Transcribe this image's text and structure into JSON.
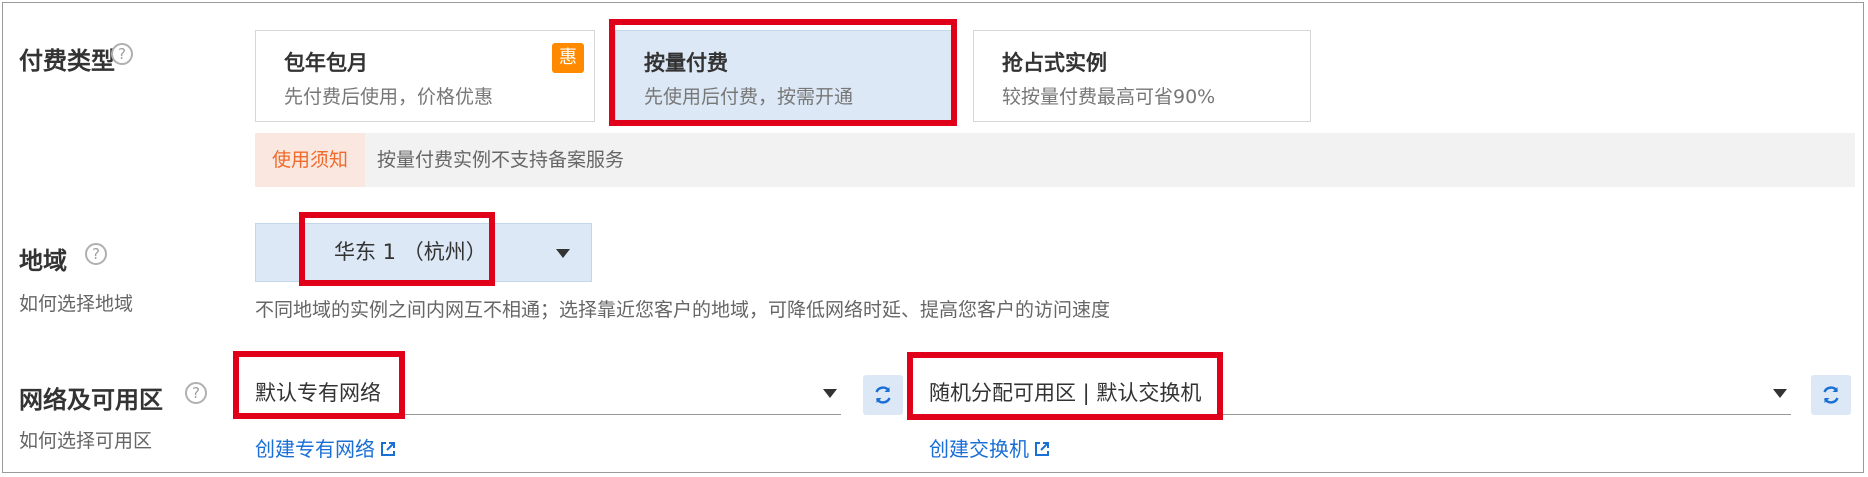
{
  "payment": {
    "label": "付费类型",
    "options": [
      {
        "title": "包年包月",
        "desc": "先付费后使用，价格优惠",
        "badge": "惠"
      },
      {
        "title": "按量付费",
        "desc": "先使用后付费，按需开通"
      },
      {
        "title": "抢占式实例",
        "desc": "较按量付费最高可省90%"
      }
    ],
    "notice_tag": "使用须知",
    "notice_text": "按量付费实例不支持备案服务"
  },
  "region": {
    "label": "地域",
    "sub_label": "如何选择地域",
    "selected": "华东 1 （杭州）",
    "hint": "不同地域的实例之间内网互不相通；选择靠近您客户的地域，可降低网络时延、提高您客户的访问速度"
  },
  "network": {
    "label": "网络及可用区",
    "sub_label": "如何选择可用区",
    "vpc_value": "默认专有网络",
    "zone_value": "随机分配可用区 | 默认交换机",
    "create_vpc_link": "创建专有网络",
    "create_switch_link": "创建交换机"
  },
  "colors": {
    "accent": "#1a6fd6",
    "selected_bg": "#dce8f5",
    "highlight_border": "#e0001a",
    "badge_bg": "#ff8a00",
    "notice_tag_text": "#f06a2a"
  },
  "icons": [
    "help-circle-icon",
    "dropdown-caret-icon",
    "refresh-icon",
    "external-link-icon"
  ]
}
